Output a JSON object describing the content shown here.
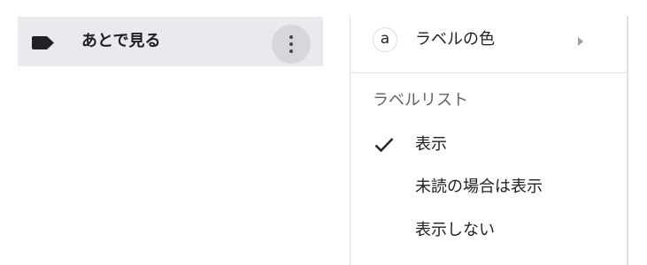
{
  "label_row": {
    "icon": "label-icon",
    "label_name": "あとで見る",
    "more_icon": "more-vertical-icon"
  },
  "menu": {
    "label_color": {
      "swatch_letter": "a",
      "label": "ラベルの色",
      "arrow_icon": "submenu-arrow-icon"
    },
    "section_heading": "ラベルリスト",
    "options": [
      {
        "label": "表示",
        "selected": true
      },
      {
        "label": "未読の場合は表示",
        "selected": false
      },
      {
        "label": "表示しない",
        "selected": false
      }
    ]
  },
  "colors": {
    "row_background": "#e8eaed",
    "button_background": "#d5d7dc",
    "label_icon": "#202124",
    "section_heading": "#5f6368"
  }
}
